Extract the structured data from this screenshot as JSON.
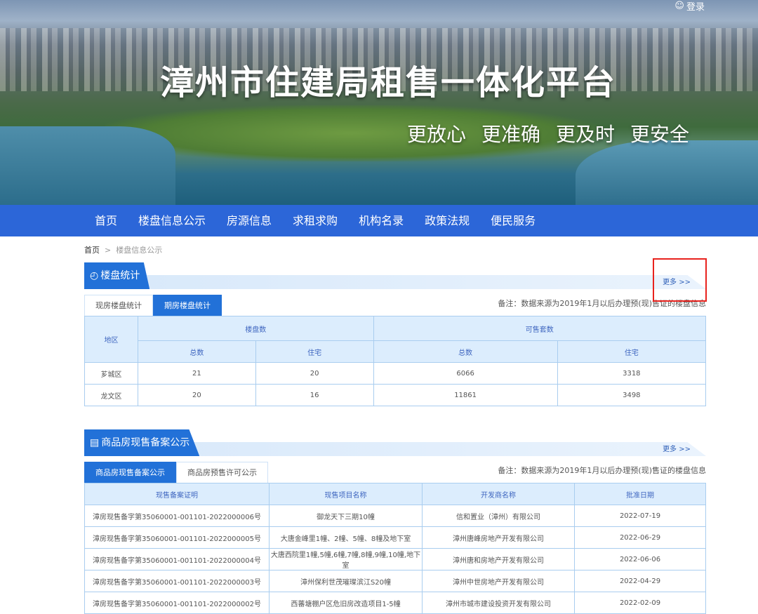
{
  "header": {
    "login": "登录",
    "title": "漳州市住建局租售一体化平台",
    "slogans": [
      "更放心",
      "更准确",
      "更及时",
      "更安全"
    ]
  },
  "nav": [
    "首页",
    "楼盘信息公示",
    "房源信息",
    "求租求购",
    "机构名录",
    "政策法规",
    "便民服务"
  ],
  "breadcrumb": {
    "home": "首页",
    "sep": ">",
    "current": "楼盘信息公示"
  },
  "stats": {
    "title": "楼盘统计",
    "more": "更多 >>",
    "tabs": [
      "现房楼盘统计",
      "期房楼盘统计"
    ],
    "active_tab": 1,
    "note": "备注：数据来源为2019年1月以后办理预(现)售证的楼盘信息",
    "headers": {
      "region": "地区",
      "group1": "楼盘数",
      "group2": "可售套数",
      "total": "总数",
      "residential": "住宅"
    },
    "rows": [
      [
        "芗城区",
        "21",
        "20",
        "6066",
        "3318"
      ],
      [
        "龙文区",
        "20",
        "16",
        "11861",
        "3498"
      ]
    ]
  },
  "filing": {
    "title": "商品房现售备案公示",
    "more": "更多 >>",
    "tabs": [
      "商品房现售备案公示",
      "商品房预售许可公示"
    ],
    "active_tab": 0,
    "note": "备注：数据来源为2019年1月以后办理预(现)售证的楼盘信息",
    "headers": [
      "现售备案证明",
      "现售项目名称",
      "开发商名称",
      "批准日期"
    ],
    "rows": [
      [
        "漳房现售备字第35060001-001101-2022000006号",
        "御龙天下三期10幢",
        "信和置业（漳州）有限公司",
        "2022-07-19"
      ],
      [
        "漳房现售备字第35060001-001101-2022000005号",
        "大唐金峰里1幢、2幢、5幢、8幢及地下室",
        "漳州唐峰房地产开发有限公司",
        "2022-06-29"
      ],
      [
        "漳房现售备字第35060001-001101-2022000004号",
        "大唐西院里1幢,5幢,6幢,7幢,8幢,9幢,10幢,地下室",
        "漳州唐和房地产开发有限公司",
        "2022-06-06"
      ],
      [
        "漳房现售备字第35060001-001101-2022000003号",
        "漳州保利世茂璀璨滨江S20幢",
        "漳州中世房地产开发有限公司",
        "2022-04-29"
      ],
      [
        "漳房现售备字第35060001-001101-2022000002号",
        "西蕃塘棚户区危旧房改造项目1-5幢",
        "漳州市城市建设投资开发有限公司",
        "2022-02-09"
      ]
    ]
  }
}
